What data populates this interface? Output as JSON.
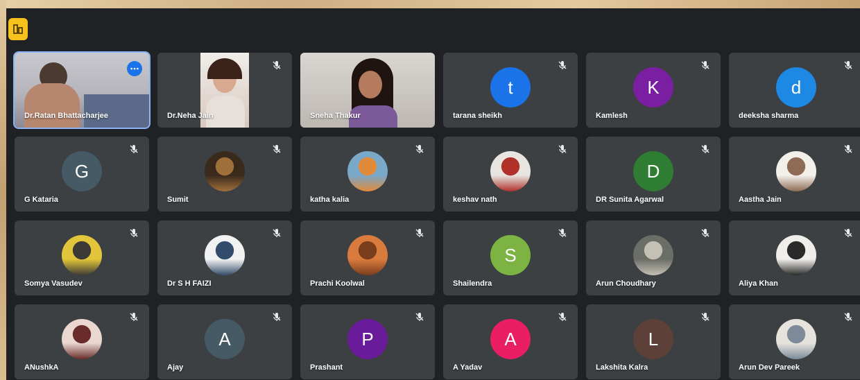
{
  "colors": {
    "meet_bg": "#202124",
    "tile_bg": "#3c4043",
    "accent": "#1a73e8",
    "active_border": "#8ab4f8",
    "toolbar_button": "#f7c21b"
  },
  "topbar": {
    "activity_icon": "meeting-details-icon"
  },
  "participants": [
    {
      "name": "Dr.Ratan Bhattacharjee",
      "kind": "video",
      "active": true,
      "more_icon": "more-options-icon"
    },
    {
      "name": "Dr.Neha Jain",
      "kind": "video",
      "muted": true
    },
    {
      "name": "Sneha Thakur",
      "kind": "video"
    },
    {
      "name": "tarana sheikh",
      "kind": "initial",
      "initial": "t",
      "color": "#1a73e8",
      "muted": true
    },
    {
      "name": "Kamlesh",
      "kind": "initial",
      "initial": "K",
      "color": "#7b1fa2",
      "muted": true
    },
    {
      "name": "deeksha sharma",
      "kind": "initial",
      "initial": "d",
      "color": "#1e88e5",
      "muted": true
    },
    {
      "name": "G Kataria",
      "kind": "initial",
      "initial": "G",
      "color": "#455a64",
      "muted": true
    },
    {
      "name": "Sumit",
      "kind": "photo",
      "photo_colors": [
        "#3a2a1c",
        "#a0703a"
      ],
      "muted": true
    },
    {
      "name": "katha kalia",
      "kind": "photo",
      "photo_colors": [
        "#7aa8c9",
        "#e08a3a"
      ],
      "muted": true
    },
    {
      "name": "keshav nath",
      "kind": "photo",
      "photo_colors": [
        "#e8e4df",
        "#b0302a"
      ],
      "muted": true
    },
    {
      "name": "DR Sunita Agarwal",
      "kind": "initial",
      "initial": "D",
      "color": "#2e7d32",
      "muted": true
    },
    {
      "name": "Aastha Jain",
      "kind": "photo",
      "photo_colors": [
        "#f3efe9",
        "#8e6b55"
      ],
      "muted": true
    },
    {
      "name": "Somya Vasudev",
      "kind": "photo",
      "photo_colors": [
        "#e2c53a",
        "#3c3a36"
      ],
      "muted": true
    },
    {
      "name": "Dr S H FAIZI",
      "kind": "photo",
      "photo_colors": [
        "#f2f2f2",
        "#344c6b"
      ],
      "muted": true
    },
    {
      "name": "Prachi Koolwal",
      "kind": "photo",
      "photo_colors": [
        "#d97b3c",
        "#7a3d1c"
      ],
      "muted": true
    },
    {
      "name": "Shailendra",
      "kind": "initial",
      "initial": "S",
      "color": "#7cb342",
      "muted": true
    },
    {
      "name": "Arun Choudhary",
      "kind": "photo",
      "photo_colors": [
        "#6b6e66",
        "#c5c0b6"
      ],
      "muted": true
    },
    {
      "name": "Aliya Khan",
      "kind": "photo",
      "photo_colors": [
        "#f0eeea",
        "#2a2a2a"
      ],
      "muted": true
    },
    {
      "name": "ANushkA",
      "kind": "photo",
      "photo_colors": [
        "#e9d7d0",
        "#6a2c2a"
      ],
      "muted": true
    },
    {
      "name": "Ajay",
      "kind": "initial",
      "initial": "A",
      "color": "#455a64",
      "muted": true
    },
    {
      "name": "Prashant",
      "kind": "initial",
      "initial": "P",
      "color": "#6a1b9a",
      "muted": true
    },
    {
      "name": "A Yadav",
      "kind": "initial",
      "initial": "A",
      "color": "#e91e63",
      "muted": true
    },
    {
      "name": "Lakshita Kalra",
      "kind": "initial",
      "initial": "L",
      "color": "#5d4037",
      "muted": true
    },
    {
      "name": "Arun Dev Pareek",
      "kind": "photo",
      "photo_colors": [
        "#e6e3dc",
        "#7c8a9a"
      ],
      "muted": true
    }
  ]
}
